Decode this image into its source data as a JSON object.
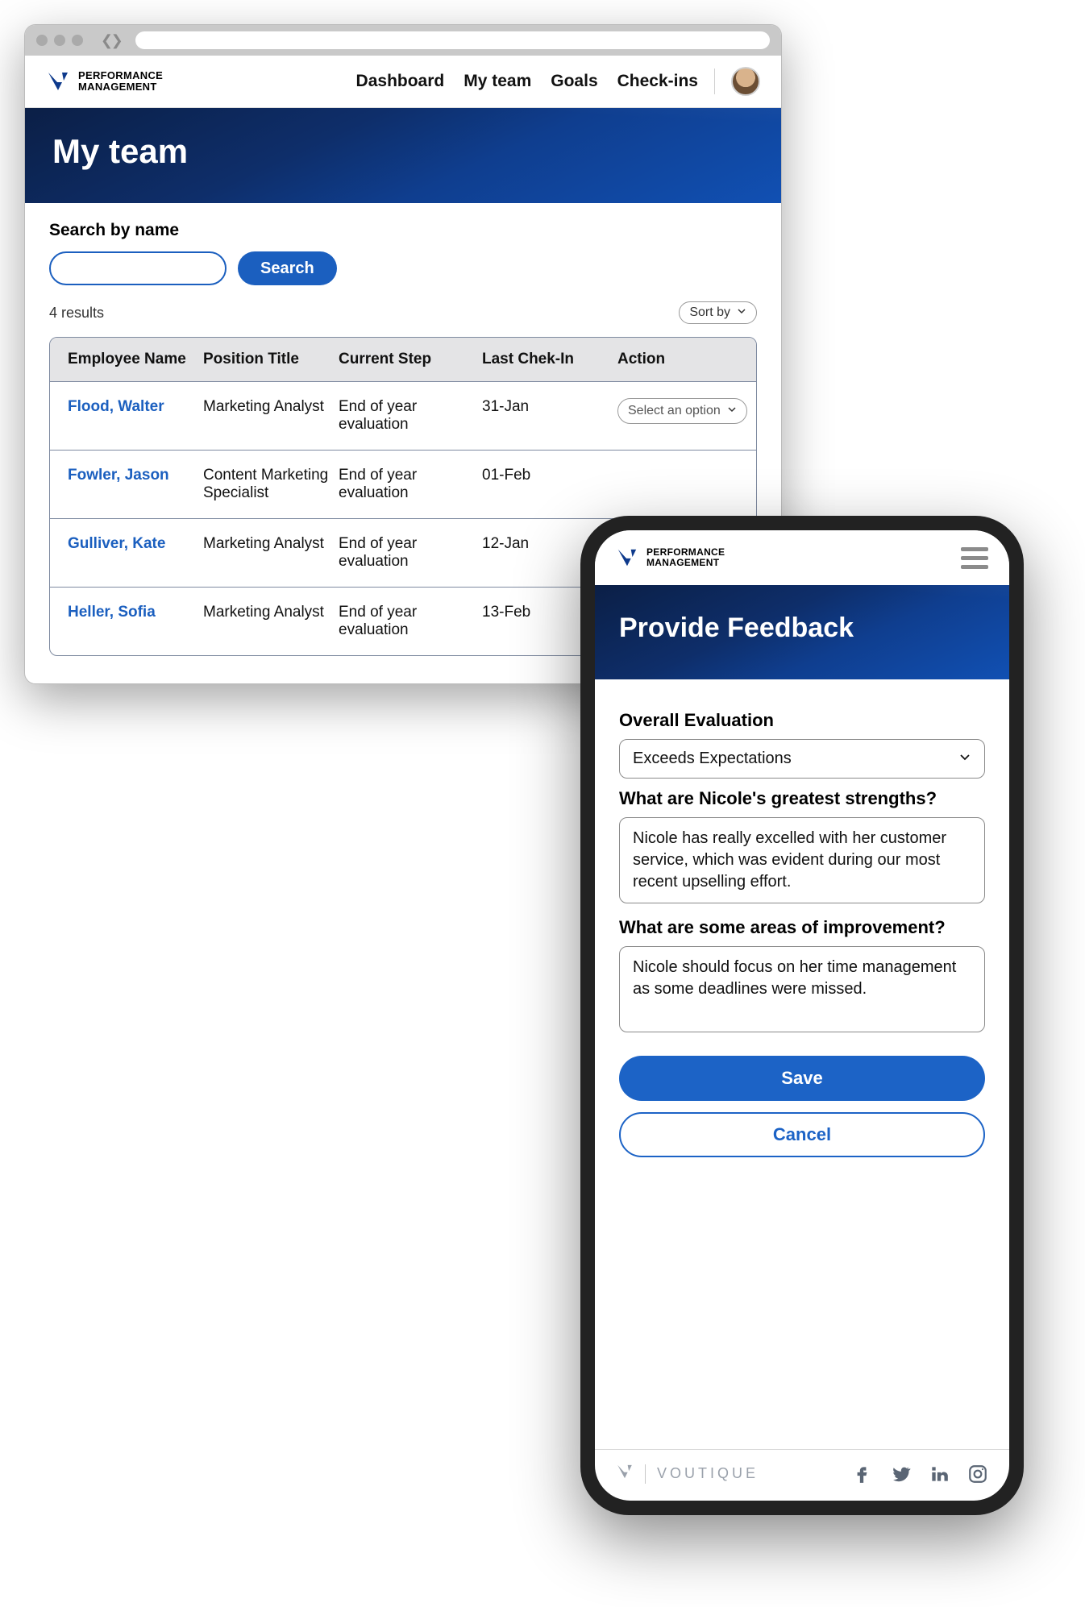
{
  "app": {
    "name_line1": "PERFORMANCE",
    "name_line2": "MANAGEMENT"
  },
  "desktop": {
    "nav": [
      "Dashboard",
      "My team",
      "Goals",
      "Check-ins"
    ],
    "page_title": "My team",
    "search": {
      "label": "Search by name",
      "button": "Search",
      "value": ""
    },
    "results_count": "4 results",
    "sort_label": "Sort by",
    "columns": {
      "name": "Employee Name",
      "title": "Position Title",
      "step": "Current Step",
      "checkin": "Last Chek-In",
      "action": "Action"
    },
    "action_placeholder": "Select an option",
    "rows": [
      {
        "name": "Flood, Walter",
        "title": "Marketing Analyst",
        "step": "End of year evaluation",
        "checkin": "31-Jan"
      },
      {
        "name": "Fowler, Jason",
        "title": "Content Marketing Specialist",
        "step": "End of year evaluation",
        "checkin": "01-Feb"
      },
      {
        "name": "Gulliver, Kate",
        "title": "Marketing Analyst",
        "step": "End of year evaluation",
        "checkin": "12-Jan"
      },
      {
        "name": "Heller, Sofia",
        "title": "Marketing Analyst",
        "step": "End of year evaluation",
        "checkin": "13-Feb"
      }
    ]
  },
  "mobile": {
    "page_title": "Provide Feedback",
    "eval_label": "Overall Evaluation",
    "eval_value": "Exceeds Expectations",
    "q1_label": "What are Nicole's greatest strengths?",
    "q1_value": "Nicole has really excelled with her customer service, which was evident during our most recent upselling effort.",
    "q2_label": "What are some areas of improvement?",
    "q2_value": "Nicole should focus on her time management as some deadlines were missed.",
    "save_label": "Save",
    "cancel_label": "Cancel",
    "footer_brand": "VOUTIQUE"
  }
}
